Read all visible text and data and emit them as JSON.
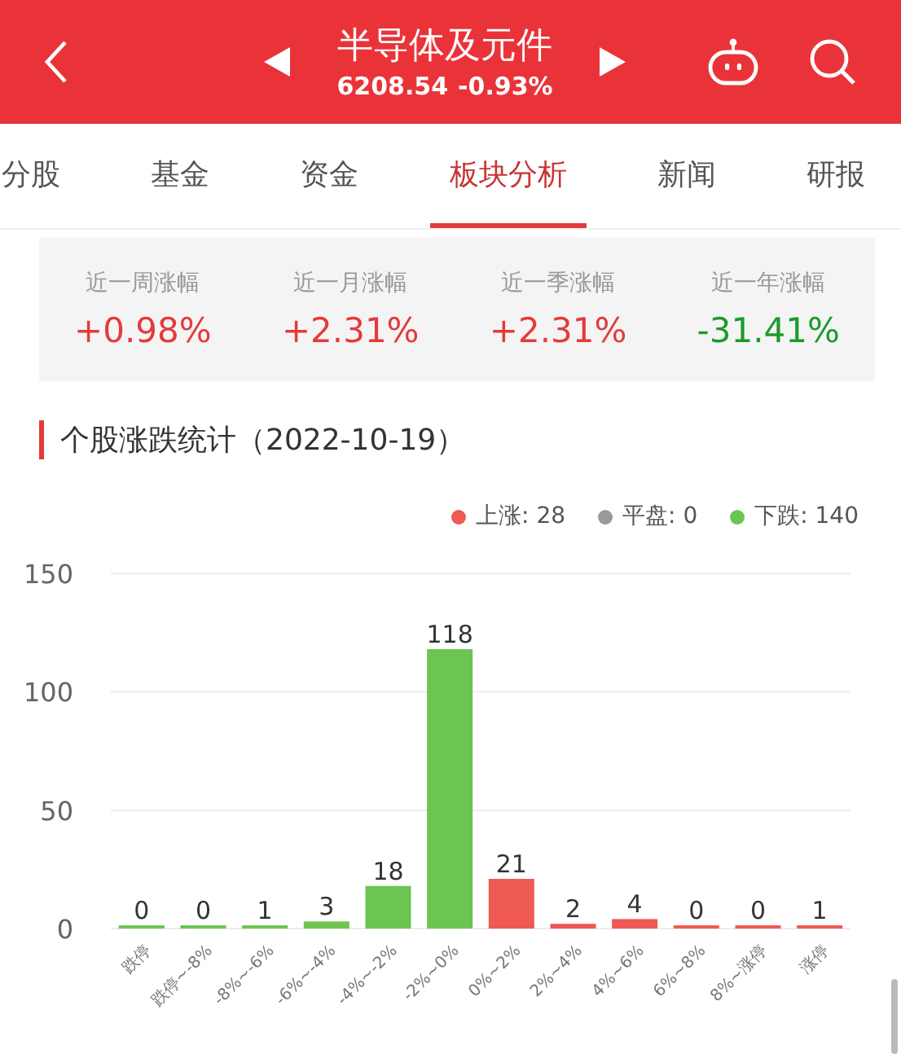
{
  "header": {
    "title": "半导体及元件",
    "price": "6208.54",
    "change": "-0.93%"
  },
  "tabs": [
    {
      "label": "分股",
      "selected": false
    },
    {
      "label": "基金",
      "selected": false
    },
    {
      "label": "资金",
      "selected": false
    },
    {
      "label": "板块分析",
      "selected": true
    },
    {
      "label": "新闻",
      "selected": false
    },
    {
      "label": "研报",
      "selected": false
    }
  ],
  "stats": [
    {
      "label": "近一周涨幅",
      "value": "+0.98%",
      "color": "#e33b3b"
    },
    {
      "label": "近一月涨幅",
      "value": "+2.31%",
      "color": "#e33b3b"
    },
    {
      "label": "近一季涨幅",
      "value": "+2.31%",
      "color": "#e33b3b"
    },
    {
      "label": "近一年涨幅",
      "value": "-31.41%",
      "color": "#1a9a2a"
    }
  ],
  "section_title": "个股涨跌统计（2022-10-19）",
  "legend": [
    {
      "label": "上涨: 28",
      "color": "#ef5a52"
    },
    {
      "label": "平盘: 0",
      "color": "#999999"
    },
    {
      "label": "下跌: 140",
      "color": "#6cc551"
    }
  ],
  "chart_data": {
    "type": "bar",
    "categories": [
      "跌停",
      "跌停~-8%",
      "-8%~-6%",
      "-6%~-4%",
      "-4%~-2%",
      "-2%~0%",
      "0%~2%",
      "2%~4%",
      "4%~6%",
      "6%~8%",
      "8%~涨停",
      "涨停"
    ],
    "series": [
      {
        "color": "#6cc551",
        "values": [
          0,
          0,
          1,
          3,
          18,
          118,
          null,
          null,
          null,
          null,
          null,
          null
        ]
      },
      {
        "color": "#ef5a52",
        "values": [
          null,
          null,
          null,
          null,
          null,
          null,
          21,
          2,
          4,
          0,
          0,
          1
        ]
      }
    ],
    "ylim": [
      0,
      150
    ],
    "yticks": [
      0,
      50,
      100,
      150
    ],
    "data_labels": true
  }
}
